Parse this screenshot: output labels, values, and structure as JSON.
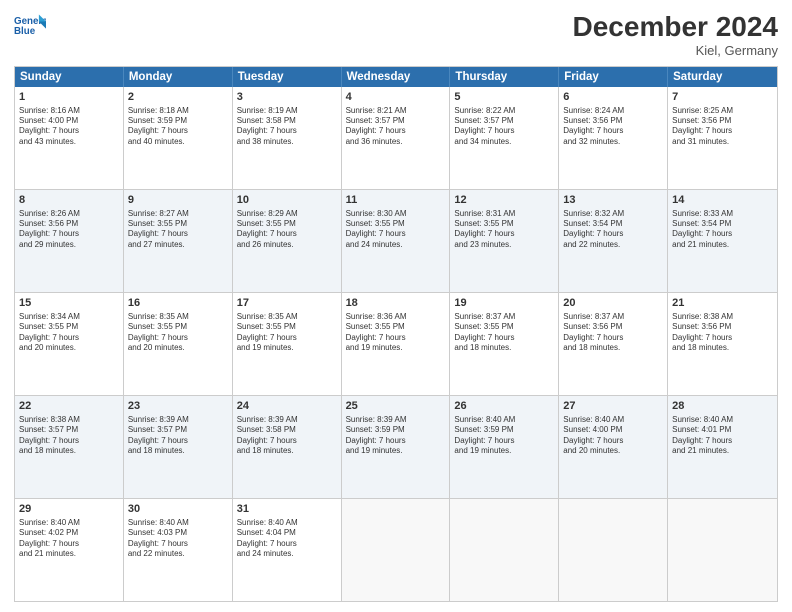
{
  "logo": {
    "line1": "General",
    "line2": "Blue"
  },
  "title": "December 2024",
  "location": "Kiel, Germany",
  "header_days": [
    "Sunday",
    "Monday",
    "Tuesday",
    "Wednesday",
    "Thursday",
    "Friday",
    "Saturday"
  ],
  "rows": [
    [
      {
        "day": "1",
        "lines": [
          "Sunrise: 8:16 AM",
          "Sunset: 4:00 PM",
          "Daylight: 7 hours",
          "and 43 minutes."
        ]
      },
      {
        "day": "2",
        "lines": [
          "Sunrise: 8:18 AM",
          "Sunset: 3:59 PM",
          "Daylight: 7 hours",
          "and 40 minutes."
        ]
      },
      {
        "day": "3",
        "lines": [
          "Sunrise: 8:19 AM",
          "Sunset: 3:58 PM",
          "Daylight: 7 hours",
          "and 38 minutes."
        ]
      },
      {
        "day": "4",
        "lines": [
          "Sunrise: 8:21 AM",
          "Sunset: 3:57 PM",
          "Daylight: 7 hours",
          "and 36 minutes."
        ]
      },
      {
        "day": "5",
        "lines": [
          "Sunrise: 8:22 AM",
          "Sunset: 3:57 PM",
          "Daylight: 7 hours",
          "and 34 minutes."
        ]
      },
      {
        "day": "6",
        "lines": [
          "Sunrise: 8:24 AM",
          "Sunset: 3:56 PM",
          "Daylight: 7 hours",
          "and 32 minutes."
        ]
      },
      {
        "day": "7",
        "lines": [
          "Sunrise: 8:25 AM",
          "Sunset: 3:56 PM",
          "Daylight: 7 hours",
          "and 31 minutes."
        ]
      }
    ],
    [
      {
        "day": "8",
        "lines": [
          "Sunrise: 8:26 AM",
          "Sunset: 3:56 PM",
          "Daylight: 7 hours",
          "and 29 minutes."
        ]
      },
      {
        "day": "9",
        "lines": [
          "Sunrise: 8:27 AM",
          "Sunset: 3:55 PM",
          "Daylight: 7 hours",
          "and 27 minutes."
        ]
      },
      {
        "day": "10",
        "lines": [
          "Sunrise: 8:29 AM",
          "Sunset: 3:55 PM",
          "Daylight: 7 hours",
          "and 26 minutes."
        ]
      },
      {
        "day": "11",
        "lines": [
          "Sunrise: 8:30 AM",
          "Sunset: 3:55 PM",
          "Daylight: 7 hours",
          "and 24 minutes."
        ]
      },
      {
        "day": "12",
        "lines": [
          "Sunrise: 8:31 AM",
          "Sunset: 3:55 PM",
          "Daylight: 7 hours",
          "and 23 minutes."
        ]
      },
      {
        "day": "13",
        "lines": [
          "Sunrise: 8:32 AM",
          "Sunset: 3:54 PM",
          "Daylight: 7 hours",
          "and 22 minutes."
        ]
      },
      {
        "day": "14",
        "lines": [
          "Sunrise: 8:33 AM",
          "Sunset: 3:54 PM",
          "Daylight: 7 hours",
          "and 21 minutes."
        ]
      }
    ],
    [
      {
        "day": "15",
        "lines": [
          "Sunrise: 8:34 AM",
          "Sunset: 3:55 PM",
          "Daylight: 7 hours",
          "and 20 minutes."
        ]
      },
      {
        "day": "16",
        "lines": [
          "Sunrise: 8:35 AM",
          "Sunset: 3:55 PM",
          "Daylight: 7 hours",
          "and 20 minutes."
        ]
      },
      {
        "day": "17",
        "lines": [
          "Sunrise: 8:35 AM",
          "Sunset: 3:55 PM",
          "Daylight: 7 hours",
          "and 19 minutes."
        ]
      },
      {
        "day": "18",
        "lines": [
          "Sunrise: 8:36 AM",
          "Sunset: 3:55 PM",
          "Daylight: 7 hours",
          "and 19 minutes."
        ]
      },
      {
        "day": "19",
        "lines": [
          "Sunrise: 8:37 AM",
          "Sunset: 3:55 PM",
          "Daylight: 7 hours",
          "and 18 minutes."
        ]
      },
      {
        "day": "20",
        "lines": [
          "Sunrise: 8:37 AM",
          "Sunset: 3:56 PM",
          "Daylight: 7 hours",
          "and 18 minutes."
        ]
      },
      {
        "day": "21",
        "lines": [
          "Sunrise: 8:38 AM",
          "Sunset: 3:56 PM",
          "Daylight: 7 hours",
          "and 18 minutes."
        ]
      }
    ],
    [
      {
        "day": "22",
        "lines": [
          "Sunrise: 8:38 AM",
          "Sunset: 3:57 PM",
          "Daylight: 7 hours",
          "and 18 minutes."
        ]
      },
      {
        "day": "23",
        "lines": [
          "Sunrise: 8:39 AM",
          "Sunset: 3:57 PM",
          "Daylight: 7 hours",
          "and 18 minutes."
        ]
      },
      {
        "day": "24",
        "lines": [
          "Sunrise: 8:39 AM",
          "Sunset: 3:58 PM",
          "Daylight: 7 hours",
          "and 18 minutes."
        ]
      },
      {
        "day": "25",
        "lines": [
          "Sunrise: 8:39 AM",
          "Sunset: 3:59 PM",
          "Daylight: 7 hours",
          "and 19 minutes."
        ]
      },
      {
        "day": "26",
        "lines": [
          "Sunrise: 8:40 AM",
          "Sunset: 3:59 PM",
          "Daylight: 7 hours",
          "and 19 minutes."
        ]
      },
      {
        "day": "27",
        "lines": [
          "Sunrise: 8:40 AM",
          "Sunset: 4:00 PM",
          "Daylight: 7 hours",
          "and 20 minutes."
        ]
      },
      {
        "day": "28",
        "lines": [
          "Sunrise: 8:40 AM",
          "Sunset: 4:01 PM",
          "Daylight: 7 hours",
          "and 21 minutes."
        ]
      }
    ],
    [
      {
        "day": "29",
        "lines": [
          "Sunrise: 8:40 AM",
          "Sunset: 4:02 PM",
          "Daylight: 7 hours",
          "and 21 minutes."
        ]
      },
      {
        "day": "30",
        "lines": [
          "Sunrise: 8:40 AM",
          "Sunset: 4:03 PM",
          "Daylight: 7 hours",
          "and 22 minutes."
        ]
      },
      {
        "day": "31",
        "lines": [
          "Sunrise: 8:40 AM",
          "Sunset: 4:04 PM",
          "Daylight: 7 hours",
          "and 24 minutes."
        ]
      },
      {
        "day": "",
        "lines": []
      },
      {
        "day": "",
        "lines": []
      },
      {
        "day": "",
        "lines": []
      },
      {
        "day": "",
        "lines": []
      }
    ]
  ]
}
